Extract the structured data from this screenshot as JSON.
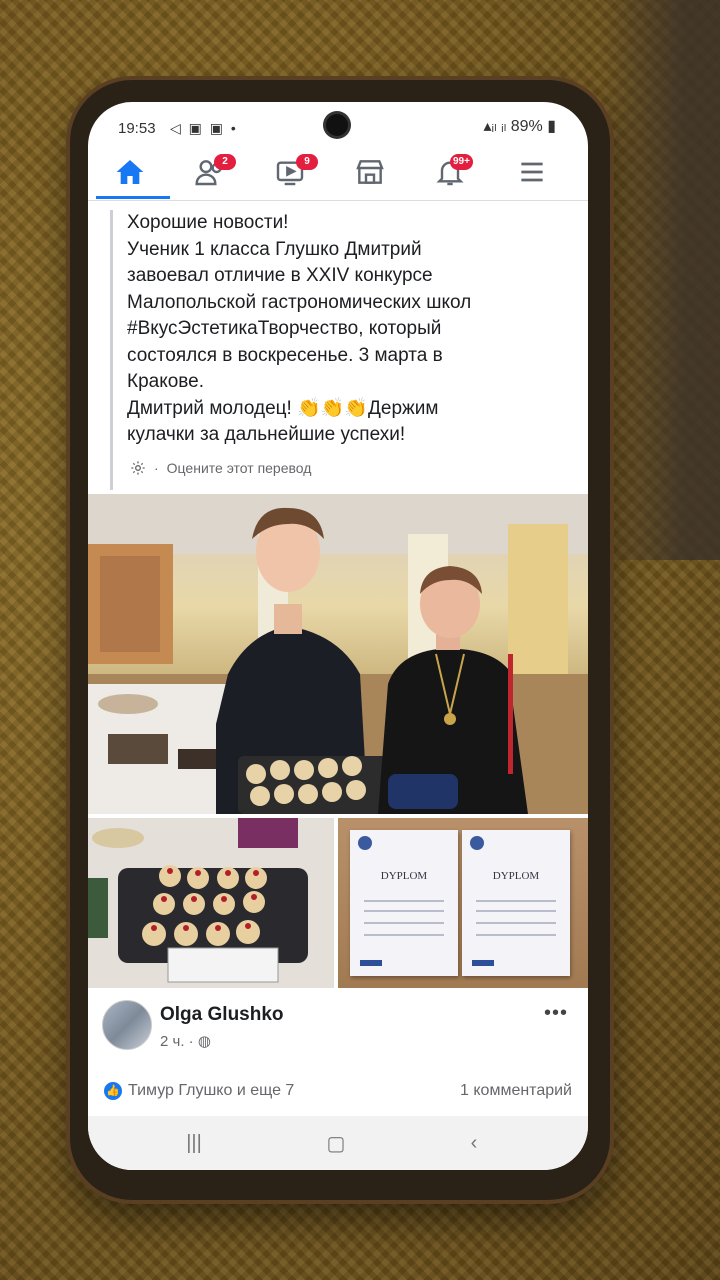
{
  "status_bar": {
    "time": "19:53",
    "left_icons": "◁ ▣ ▣ •",
    "battery": "89%"
  },
  "nav": {
    "friends_badge": "2",
    "watch_badge": "9",
    "notifications_badge": "99+"
  },
  "post": {
    "lines": [
      "Хорошие новости!",
      "Ученик 1 класса Глушко Дмитрий",
      "завоевал отличие в XXIV конкурсе",
      "Малопольской гастрономических школ",
      "#ВкусЭстетикаТворчество, который",
      "состоялся в воскресенье. 3 марта в",
      "Кракове.",
      "Дмитрий молодец! 👏👏👏Держим",
      "кулачки за дальнейшие успехи!"
    ],
    "rate_translation": "Оцените этот перевод",
    "diploma_title": "DYPLOM"
  },
  "author": {
    "name": "Olga Glushko",
    "time": "2 ч. · "
  },
  "reactions": {
    "text": "Тимур Глушко и еще 7",
    "comments": "1 комментарий"
  },
  "icons": {
    "home": "home-icon",
    "friends": "friends-icon",
    "watch": "watch-icon",
    "marketplace": "marketplace-icon",
    "notifications": "bell-icon",
    "menu": "menu-icon"
  },
  "colors": {
    "accent": "#1877f2",
    "badge": "#e41e3f"
  }
}
